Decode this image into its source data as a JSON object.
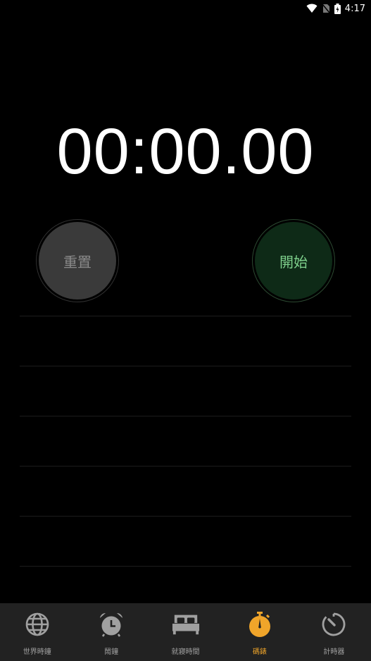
{
  "status": {
    "time": "4:17"
  },
  "stopwatch": {
    "display": "00:00.00"
  },
  "buttons": {
    "reset_label": "重置",
    "start_label": "開始"
  },
  "nav": {
    "items": [
      {
        "label": "世界時鐘",
        "icon": "globe-icon"
      },
      {
        "label": "鬧鐘",
        "icon": "alarm-clock-icon"
      },
      {
        "label": "就寢時間",
        "icon": "bed-icon"
      },
      {
        "label": "碼錶",
        "icon": "stopwatch-icon",
        "active": true
      },
      {
        "label": "計時器",
        "icon": "timer-icon"
      }
    ]
  },
  "colors": {
    "accent": "#f0a52a",
    "start_green": "#7ed08c",
    "background": "#000000"
  }
}
